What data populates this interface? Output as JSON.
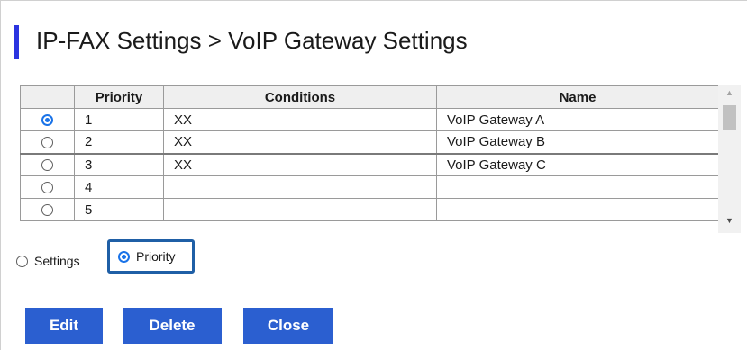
{
  "page": {
    "title": "IP-FAX Settings > VoIP Gateway Settings"
  },
  "table": {
    "headers": [
      "",
      "Priority",
      "Conditions",
      "Name"
    ],
    "rows": [
      {
        "selected": true,
        "priority": "1",
        "conditions": "XX",
        "name": "VoIP Gateway A"
      },
      {
        "selected": false,
        "priority": "2",
        "conditions": "XX",
        "name": "VoIP Gateway B"
      },
      {
        "selected": false,
        "priority": "3",
        "conditions": "XX",
        "name": "VoIP Gateway C"
      },
      {
        "selected": false,
        "priority": "4",
        "conditions": "",
        "name": ""
      },
      {
        "selected": false,
        "priority": "5",
        "conditions": "",
        "name": ""
      }
    ]
  },
  "mode": {
    "options": [
      {
        "label": "Settings",
        "selected": false
      },
      {
        "label": "Priority",
        "selected": true
      }
    ]
  },
  "buttons": {
    "edit": "Edit",
    "delete": "Delete",
    "close": "Close"
  },
  "colors": {
    "accent": "#2b34e0",
    "button": "#2b5fd0",
    "radio_selected": "#1a73e8",
    "focus_outline": "#1f5fa6"
  }
}
